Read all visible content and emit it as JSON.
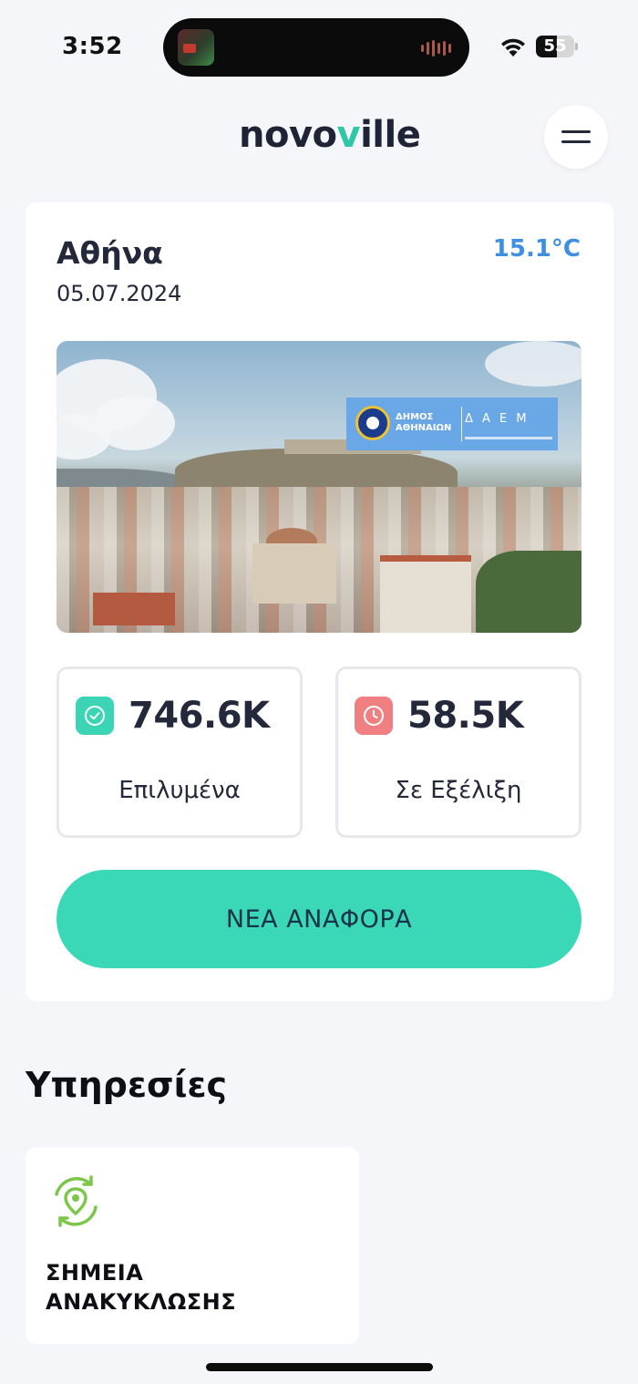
{
  "status_bar": {
    "time": "3:52",
    "battery_level": "55",
    "icons": [
      "wifi-icon",
      "battery-icon"
    ]
  },
  "header": {
    "logo_prefix": "novo",
    "logo_accent": "v",
    "logo_suffix": "ille",
    "menu_icon": "hamburger-menu-icon"
  },
  "city": {
    "name": "Αθήνα",
    "date": "05.07.2024",
    "temperature": "15.1°C",
    "photo_banner": {
      "line1": "ΔΗΜΟΣ",
      "line2": "ΑΘΗΝΑΙΩΝ",
      "logo": "Δ Α Ε Μ"
    }
  },
  "stats": {
    "resolved": {
      "value": "746.6K",
      "label": "Επιλυμένα",
      "icon": "check-circle-icon",
      "color": "#3bd4b5"
    },
    "in_progress": {
      "value": "58.5K",
      "label": "Σε Εξέλιξη",
      "icon": "clock-icon",
      "color": "#f07f82"
    }
  },
  "actions": {
    "new_report": "ΝΕΑ ΑΝΑΦΟΡΑ"
  },
  "services": {
    "title": "Υπηρεσίες",
    "items": [
      {
        "label_line1": "ΣΗΜΕΙΑ",
        "label_line2": "ΑΝΑΚΥΚΛΩΣΗΣ",
        "icon": "recycle-location-icon"
      }
    ]
  },
  "colors": {
    "accent": "#3bd8b8",
    "temperature": "#3e8fe0",
    "background": "#f5f6f9"
  }
}
